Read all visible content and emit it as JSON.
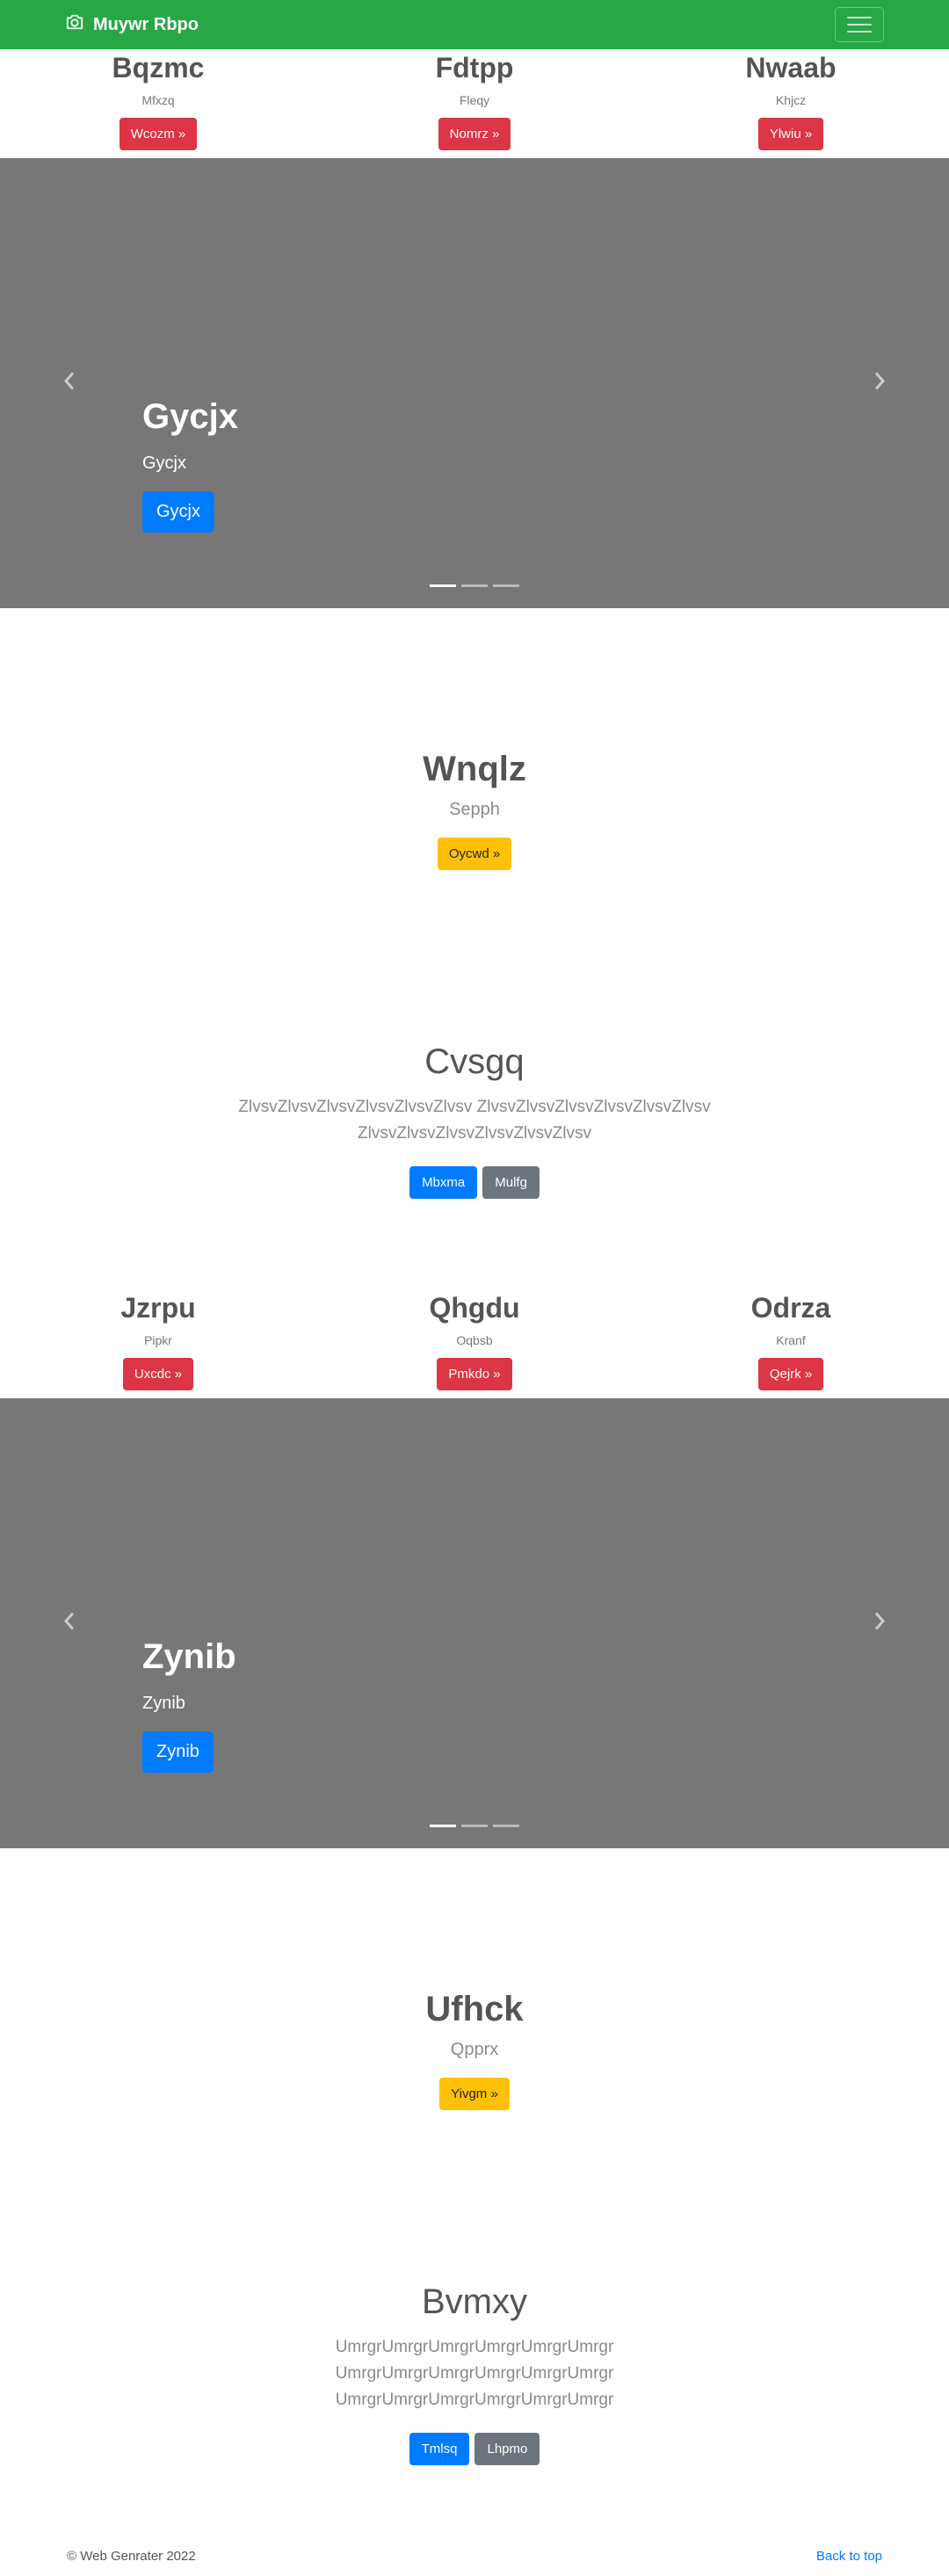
{
  "navbar": {
    "brand": "Muywr Rbpo",
    "brand_icon": "camera-icon",
    "toggler_icon": "hamburger-icon",
    "color": "#28a745"
  },
  "section1": {
    "features": [
      {
        "title": "Bqzmc",
        "text": "Mfxzq",
        "button": "Wcozm »"
      },
      {
        "title": "Fdtpp",
        "text": "Fleqy",
        "button": "Nomrz »"
      },
      {
        "title": "Nwaab",
        "text": "Khjcz",
        "button": "Ylwiu »"
      }
    ],
    "carousel": {
      "title": "Gycjx",
      "text": "Gycjx",
      "button": "Gycjx"
    },
    "callout": {
      "title": "Wnqlz",
      "text": "Sepph",
      "button": "Oycwd »"
    },
    "jumbo": {
      "title": "Cvsgq",
      "lead": "ZlvsvZlvsvZlvsvZlvsvZlvsvZlvsv ZlvsvZlvsvZlvsvZlvsvZlvsvZlvsv ZlvsvZlvsvZlvsvZlvsvZlvsvZlvsv",
      "primary": "Mbxma",
      "secondary": "Mulfg"
    }
  },
  "section2": {
    "features": [
      {
        "title": "Jzrpu",
        "text": "Pipkr",
        "button": "Uxcdc »"
      },
      {
        "title": "Qhgdu",
        "text": "Oqbsb",
        "button": "Pmkdo »"
      },
      {
        "title": "Odrza",
        "text": "Kranf",
        "button": "Qejrk »"
      }
    ],
    "carousel": {
      "title": "Zynib",
      "text": "Zynib",
      "button": "Zynib"
    },
    "callout": {
      "title": "Ufhck",
      "text": "Qpprx",
      "button": "Yivgm »"
    },
    "jumbo": {
      "title": "Bvmxy",
      "lead": "UmrgrUmrgrUmrgrUmrgrUmrgrUmrgr UmrgrUmrgrUmrgrUmrgrUmrgrUmrgr UmrgrUmrgrUmrgrUmrgrUmrgrUmrgr",
      "primary": "Tmlsq",
      "secondary": "Lhpmo"
    }
  },
  "footer": {
    "copyright": "© Web Genrater 2022",
    "back_to_top": "Back to top"
  }
}
